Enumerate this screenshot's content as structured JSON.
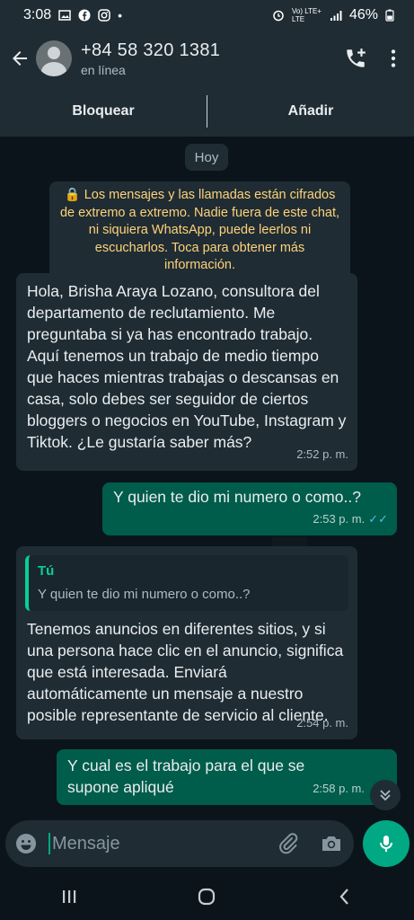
{
  "statusbar": {
    "time": "3:08",
    "network": "Vo) LTE+ LTE",
    "battery": "46%"
  },
  "header": {
    "title": "+84 58 320 1381",
    "subtitle": "en línea"
  },
  "actions": {
    "block": "Bloquear",
    "add": "Añadir"
  },
  "chat": {
    "date": "Hoy",
    "encryption": "🔒 Los mensajes y las llamadas están cifrados de extremo a extremo. Nadie fuera de este chat, ni siquiera WhatsApp, puede leerlos ni escucharlos. Toca para obtener más información.",
    "messages": [
      {
        "text": "Hola, Brisha Araya Lozano, consultora del departamento de reclutamiento. Me preguntaba si ya has encontrado trabajo. Aquí tenemos un trabajo de medio tiempo que haces mientras trabajas o descansas en casa, solo debes ser seguidor de ciertos bloggers o negocios en YouTube, Instagram y Tiktok. ¿Le gustaría saber más?",
        "time": "2:52 p. m."
      },
      {
        "text": "Y quien te dio mi numero o como..?",
        "time": "2:53 p. m."
      },
      {
        "quote_author": "Tú",
        "quote_text": "Y quien te dio mi numero o como..?",
        "text": "Tenemos anuncios en diferentes sitios, y si una persona hace clic en el anuncio, significa que está interesada. Enviará automáticamente un mensaje a nuestro posible representante de servicio al cliente.",
        "time": "2:54 p. m."
      },
      {
        "text": "Y cual es el trabajo para el que se supone apliqué",
        "time": "2:58 p. m."
      }
    ]
  },
  "input": {
    "placeholder": "Mensaje"
  },
  "icons": {
    "back": "arrow-left",
    "call": "call-add",
    "menu": "more-vertical",
    "emoji": "emoji",
    "attach": "paperclip",
    "camera": "camera",
    "mic": "microphone",
    "scroll": "double-chevron-down"
  },
  "colors": {
    "header": "#1f2c34",
    "background": "#0b141a",
    "outgoing": "#005c4b",
    "incoming": "#1f2c34",
    "accent": "#00a884",
    "notice": "#ffd279",
    "read_ticks": "#53bdeb"
  }
}
